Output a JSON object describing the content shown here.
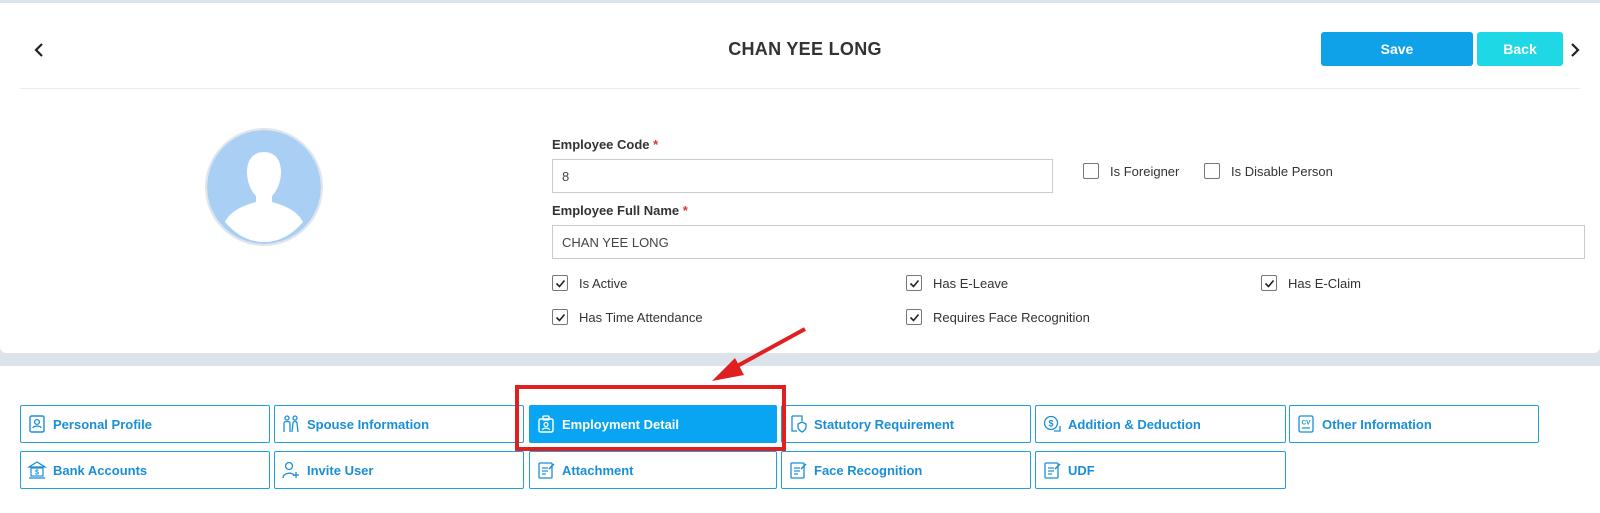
{
  "header": {
    "title": "CHAN YEE LONG",
    "save_label": "Save",
    "back_label": "Back"
  },
  "form": {
    "employee_code_label": "Employee Code",
    "employee_code_value": "8",
    "required_marker": "*",
    "employee_full_name_label": "Employee Full Name",
    "employee_full_name_value": "CHAN YEE LONG",
    "checkboxes": {
      "is_foreigner": {
        "label": "Is Foreigner",
        "checked": false
      },
      "is_disable_person": {
        "label": "Is Disable Person",
        "checked": false
      },
      "is_active": {
        "label": "Is Active",
        "checked": true
      },
      "has_e_leave": {
        "label": "Has E-Leave",
        "checked": true
      },
      "has_e_claim": {
        "label": "Has E-Claim",
        "checked": true
      },
      "has_time_attendance": {
        "label": "Has Time Attendance",
        "checked": true
      },
      "requires_face_recognition": {
        "label": "Requires Face Recognition",
        "checked": true
      }
    }
  },
  "tabs": [
    {
      "label": "Personal Profile",
      "icon": "profile-icon"
    },
    {
      "label": "Spouse Information",
      "icon": "couple-icon"
    },
    {
      "label": "Employment Detail",
      "icon": "briefcase-icon",
      "active": true
    },
    {
      "label": "Statutory Requirement",
      "icon": "shield-document-icon"
    },
    {
      "label": "Addition & Deduction",
      "icon": "money-icon"
    },
    {
      "label": "Other Information",
      "icon": "cv-icon"
    },
    {
      "label": "Bank Accounts",
      "icon": "bank-icon"
    },
    {
      "label": "Invite User",
      "icon": "add-user-icon"
    },
    {
      "label": "Attachment",
      "icon": "edit-document-icon"
    },
    {
      "label": "Face Recognition",
      "icon": "edit-document-icon"
    },
    {
      "label": "UDF",
      "icon": "edit-document-icon"
    }
  ],
  "colors": {
    "accent": "#0fa2e8",
    "back_button": "#1ed8e5",
    "annotation": "#e02020"
  }
}
